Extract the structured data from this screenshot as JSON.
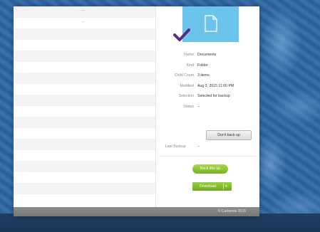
{
  "file_list": {
    "rows": [
      "–",
      "–",
      "",
      "",
      "",
      "",
      "",
      "",
      "",
      "",
      "",
      "",
      "",
      "",
      "",
      "",
      "",
      ""
    ]
  },
  "details": {
    "file_icon": "document-icon",
    "check_icon": "checkmark-icon",
    "colors": {
      "icon_bg": "#6cc3ec",
      "check": "#5b2a86",
      "accent_green": "#86bf2e"
    },
    "properties": [
      {
        "key": "Name",
        "value": "Documents"
      },
      {
        "key": "Kind",
        "value": "Folder"
      },
      {
        "key": "Child Count",
        "value": "3 items"
      },
      {
        "key": "Modified",
        "value": "Aug 3, 2015 11:00 PM"
      },
      {
        "key": "Selection",
        "value": "Selected for backup"
      },
      {
        "key": "Status",
        "value": "–"
      }
    ],
    "dont_back_up_label": "Don't back up",
    "last_backup": {
      "key": "Last Backup",
      "value": "–"
    },
    "back_up_label": "Back this up",
    "download_label": "Download"
  },
  "footer": {
    "copyright": "© Carbonite 2015"
  }
}
